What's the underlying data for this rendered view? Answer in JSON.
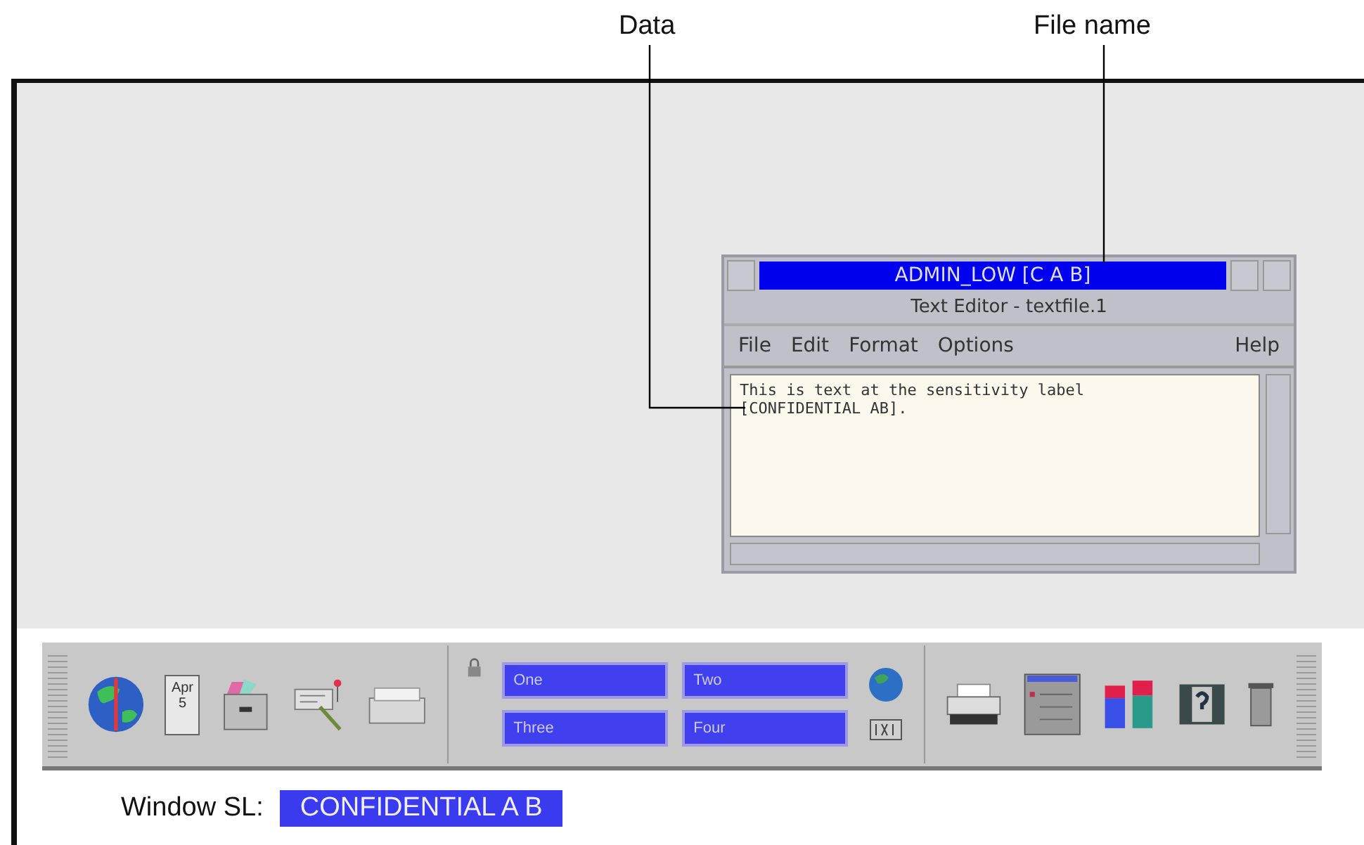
{
  "callouts": [
    {
      "label": "Data"
    },
    {
      "label": "File name"
    }
  ],
  "window": {
    "label_bar": "ADMIN_LOW [C A B]",
    "title": "Text Editor - textfile.1",
    "menu": [
      "File",
      "Edit",
      "Format",
      "Options"
    ],
    "help_menu": "Help",
    "text": [
      "This is text at the sensitivity label",
      "[CONFIDENTIAL AB]."
    ]
  },
  "front_panel": {
    "calendar": {
      "month": "Apr",
      "day": "5"
    },
    "workspaces": [
      {
        "label": "One"
      },
      {
        "label": "Two"
      },
      {
        "label": "Three"
      },
      {
        "label": "Four"
      }
    ]
  },
  "status": {
    "label": "Window SL:",
    "value": "CONFIDENTIAL A B"
  }
}
